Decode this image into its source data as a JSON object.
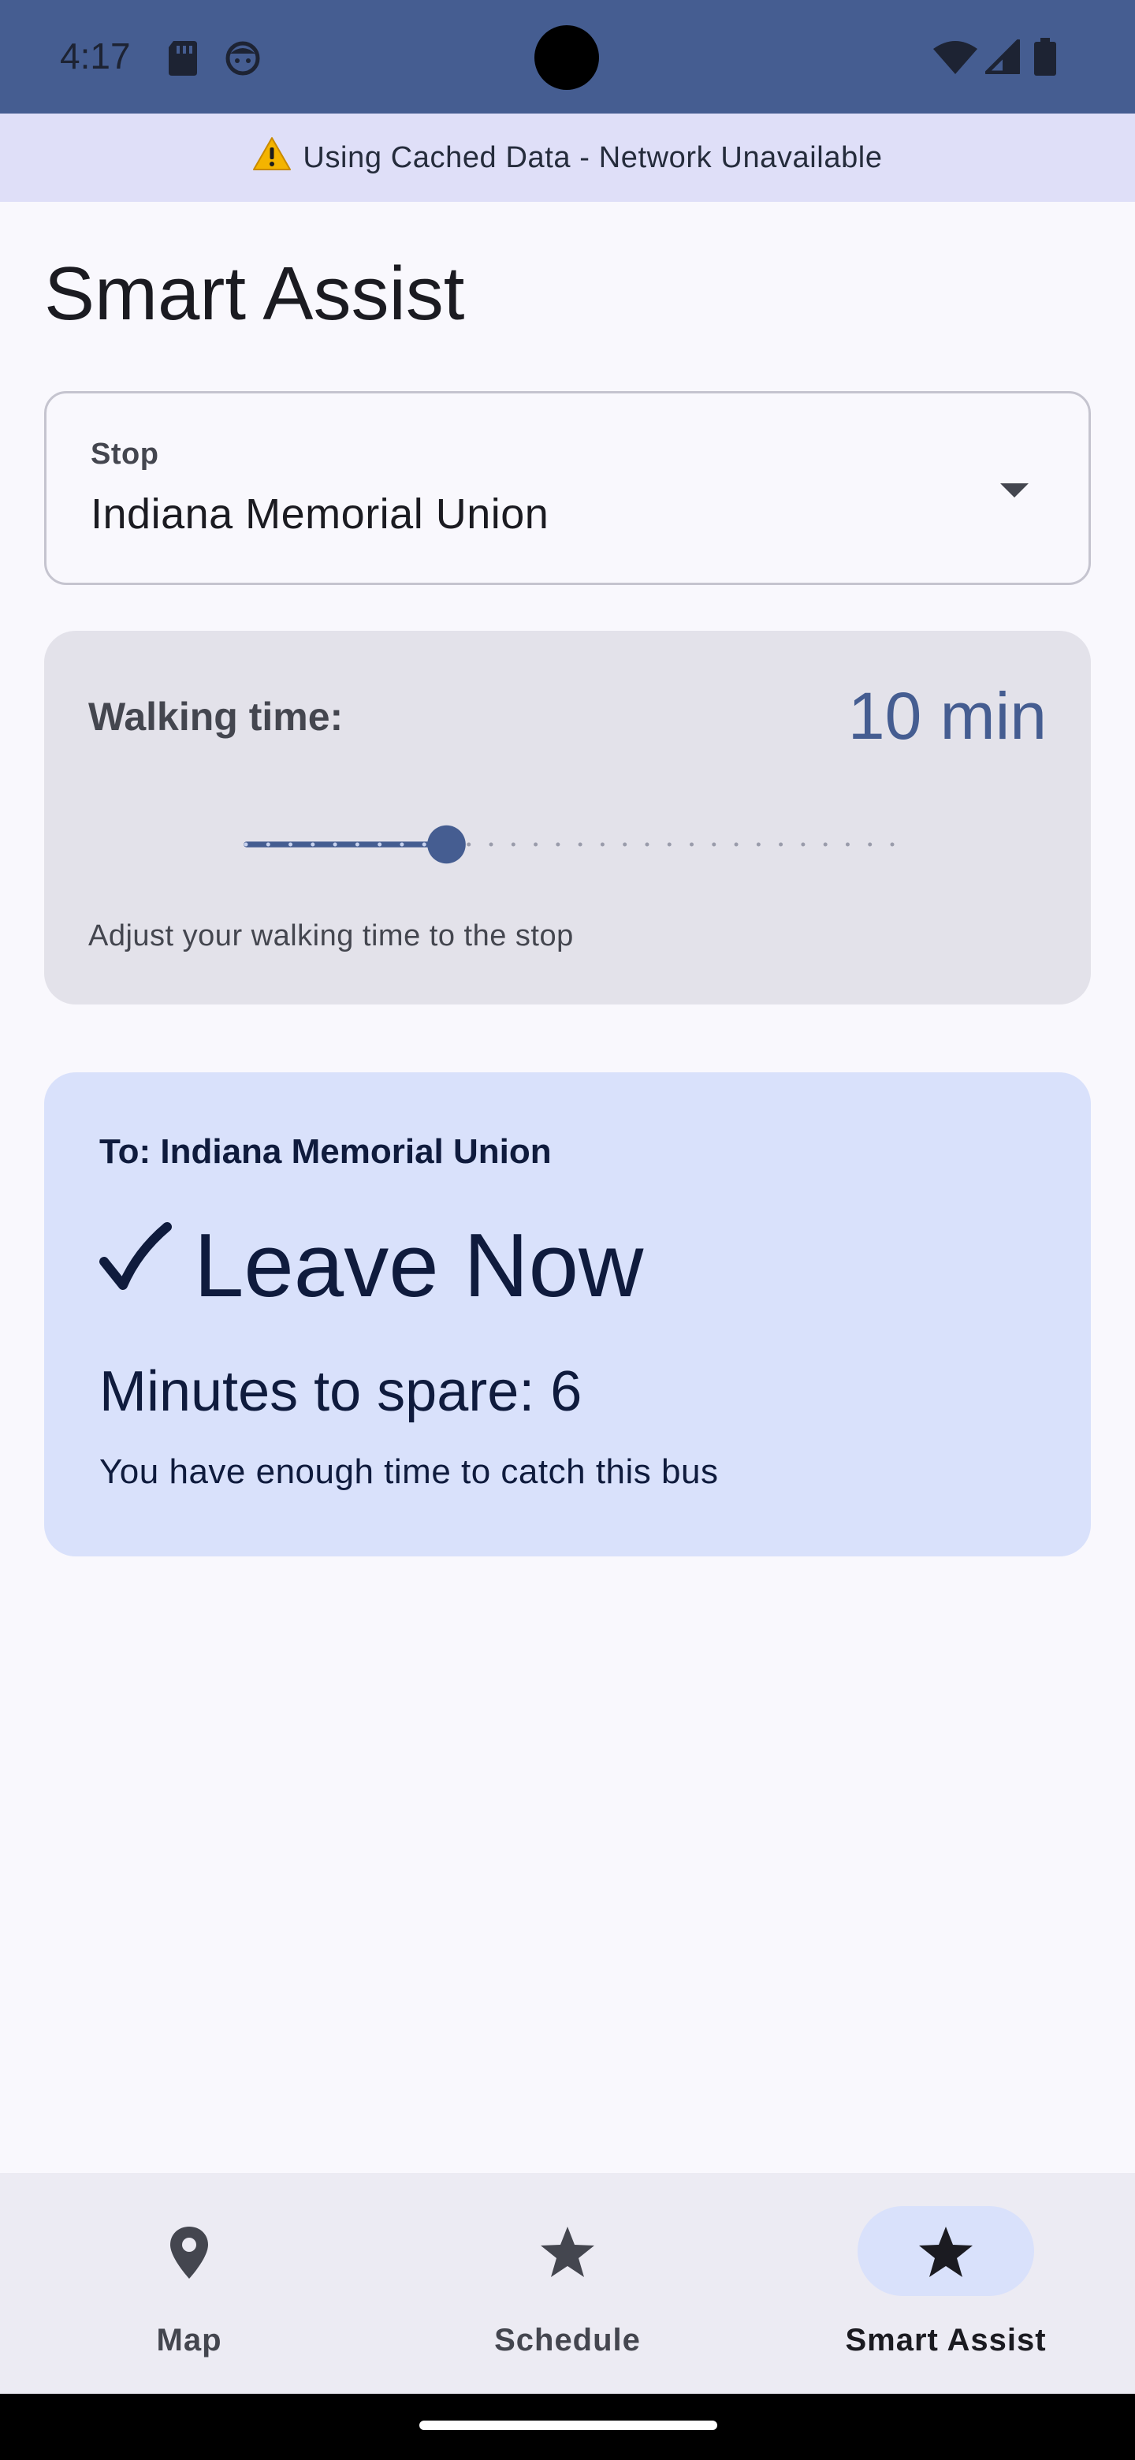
{
  "status_bar": {
    "time": "4:17",
    "icons": [
      "sd-card-icon",
      "face-icon",
      "wifi-icon",
      "signal-icon",
      "battery-icon"
    ]
  },
  "banner": {
    "icon": "warning-icon",
    "text": "Using Cached Data - Network Unavailable"
  },
  "page": {
    "title": "Smart Assist"
  },
  "stop_dropdown": {
    "label": "Stop",
    "value": "Indiana Memorial Union",
    "icon": "dropdown-arrow-icon"
  },
  "walking": {
    "label": "Walking time:",
    "value": "10 min",
    "hint": "Adjust your walking time to the stop",
    "slider_value": 10,
    "slider_min": 1,
    "slider_max": 30,
    "slider_fraction": 0.31
  },
  "result": {
    "destination": "To: Indiana Memorial Union",
    "icon": "check-icon",
    "headline": "Leave Now",
    "spare": "Minutes to spare: 6",
    "hint": "You have enough time to catch this bus"
  },
  "nav": {
    "items": [
      {
        "label": "Map",
        "icon": "map-pin-icon",
        "active": false
      },
      {
        "label": "Schedule",
        "icon": "star-icon",
        "active": false
      },
      {
        "label": "Smart Assist",
        "icon": "star-icon",
        "active": true
      }
    ]
  },
  "colors": {
    "status_bar": "#455d91",
    "banner": "#dfdff8",
    "card": "#e3e2ea",
    "result_card": "#d9e1fb",
    "accent": "#455d91",
    "nav_active": "#d9e1fb"
  }
}
